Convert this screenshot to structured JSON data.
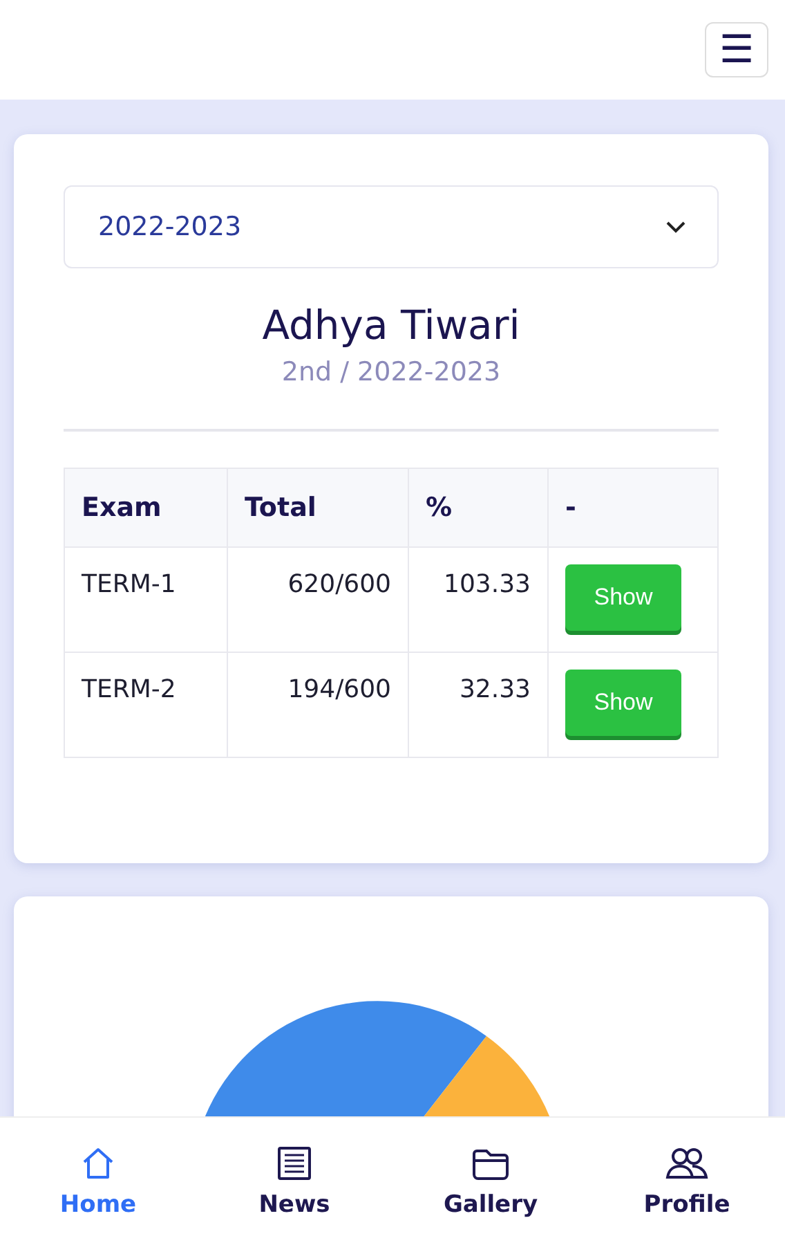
{
  "header": {
    "menu_button": "☰"
  },
  "result_card": {
    "year_select": {
      "value": "2022-2023"
    },
    "student_name": "Adhya Tiwari",
    "class_session": "2nd / 2022-2023",
    "table": {
      "columns": [
        "Exam",
        "Total",
        "%",
        "-"
      ],
      "rows": [
        {
          "exam": "TERM-1",
          "total": "620/600",
          "percent": "103.33",
          "action": "Show"
        },
        {
          "exam": "TERM-2",
          "total": "194/600",
          "percent": "32.33",
          "action": "Show"
        }
      ]
    }
  },
  "bottom_nav": [
    {
      "label": "Home",
      "kind": "home",
      "selected": true
    },
    {
      "label": "News",
      "kind": "news",
      "selected": false
    },
    {
      "label": "Gallery",
      "kind": "gallery",
      "selected": false
    },
    {
      "label": "Profile",
      "kind": "profile",
      "selected": false
    }
  ]
}
